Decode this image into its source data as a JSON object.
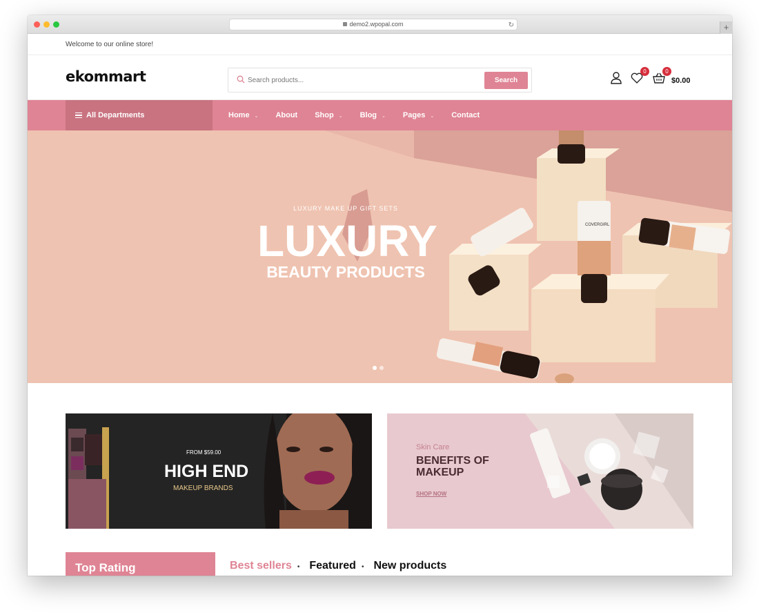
{
  "browser": {
    "url": "demo2.wpopal.com",
    "reload_icon": "reload-icon",
    "new_tab_icon": "plus-icon"
  },
  "topbar": {
    "welcome": "Welcome to our online store!"
  },
  "header": {
    "logo": "ekommart",
    "search": {
      "placeholder": "Search products...",
      "button": "Search"
    },
    "wishlist_count": "0",
    "cart_count": "0",
    "cart_total": "$0.00"
  },
  "nav": {
    "departments": "All Departments",
    "items": [
      {
        "label": "Home",
        "has_dropdown": true
      },
      {
        "label": "About",
        "has_dropdown": false
      },
      {
        "label": "Shop",
        "has_dropdown": true
      },
      {
        "label": "Blog",
        "has_dropdown": true
      },
      {
        "label": "Pages",
        "has_dropdown": true
      },
      {
        "label": "Contact",
        "has_dropdown": false
      }
    ]
  },
  "hero": {
    "eyebrow": "LUXURY MAKE UP GIFT SETS",
    "title": "LUXURY",
    "subtitle": "BEAUTY PRODUCTS",
    "product_label": "COVERGIRL",
    "slides": 2,
    "active_slide": 1
  },
  "promos": {
    "high_end": {
      "from": "FROM $59.00",
      "title": "HIGH END",
      "subtitle": "MAKEUP BRANDS"
    },
    "benefits": {
      "eyebrow": "Skin Care",
      "title": "BENEFITS OF MAKEUP",
      "link": "SHOP NOW"
    }
  },
  "top_rating": {
    "title": "Top Rating"
  },
  "product_tabs": [
    {
      "label": "Best sellers",
      "active": true
    },
    {
      "label": "Featured",
      "active": false
    },
    {
      "label": "New products",
      "active": false
    }
  ],
  "colors": {
    "accent": "#df8494",
    "accent_dark": "#c97381",
    "badge": "#d62e3b",
    "hero_bg": "#efc3b1"
  }
}
